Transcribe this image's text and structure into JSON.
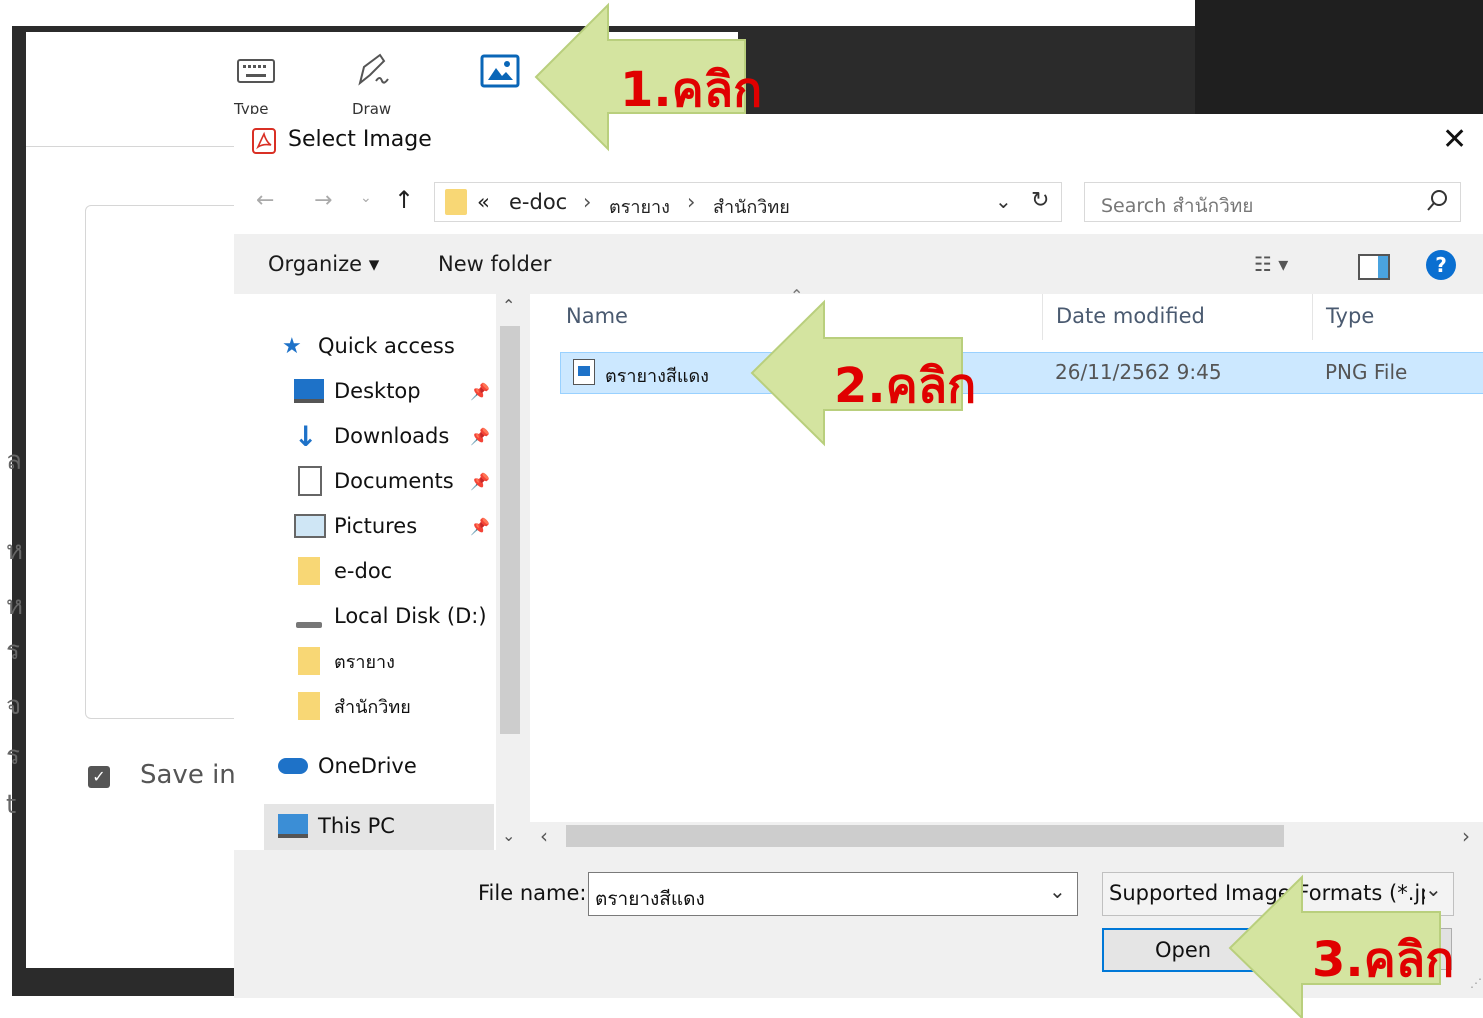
{
  "colors": {
    "accent": "#0078d7",
    "selection": "#cce8ff",
    "annotation_arrow": "#d4e4a0",
    "annotation_text": "#e00000",
    "folder": "#f8d775"
  },
  "background_app": {
    "toolbar": [
      {
        "icon": "keyboard-icon",
        "label": "Type"
      },
      {
        "icon": "draw-pen-icon",
        "label": "Draw"
      },
      {
        "icon": "image-icon",
        "label": "Image"
      }
    ],
    "save_label": "Save in",
    "save_checked": true,
    "edge_fragments": [
      "ล",
      "ห",
      "ห",
      "ร",
      "จ",
      "ร",
      "t"
    ]
  },
  "dialog": {
    "title": "Select Image",
    "close_glyph": "✕",
    "breadcrumb": {
      "prefix": "«",
      "parts": [
        "e-doc",
        "ตรายาง",
        "สำนักวิทย"
      ]
    },
    "search_placeholder": "Search สำนักวิทย",
    "toolbar": {
      "organize": "Organize ▾",
      "new_folder": "New folder"
    },
    "nav": [
      {
        "icon": "quick-access-star-icon",
        "label": "Quick access",
        "pinned": false
      },
      {
        "icon": "desktop-icon",
        "label": "Desktop",
        "pinned": true
      },
      {
        "icon": "downloads-icon",
        "label": "Downloads",
        "pinned": true
      },
      {
        "icon": "documents-icon",
        "label": "Documents",
        "pinned": true
      },
      {
        "icon": "pictures-icon",
        "label": "Pictures",
        "pinned": true
      },
      {
        "icon": "folder-icon",
        "label": "e-doc",
        "pinned": false
      },
      {
        "icon": "local-disk-icon",
        "label": "Local Disk (D:)",
        "pinned": false
      },
      {
        "icon": "folder-icon",
        "label": "ตรายาง",
        "pinned": false
      },
      {
        "icon": "folder-icon",
        "label": "สำนักวิทย",
        "pinned": false
      },
      {
        "icon": "onedrive-icon",
        "label": "OneDrive",
        "pinned": false
      },
      {
        "icon": "this-pc-icon",
        "label": "This PC",
        "pinned": false
      }
    ],
    "columns": {
      "name": "Name",
      "date": "Date modified",
      "type": "Type"
    },
    "files": [
      {
        "name": "ตรายางสีแดง",
        "date": "26/11/2562 9:45",
        "type": "PNG File",
        "selected": true
      }
    ],
    "file_name_label": "File name:",
    "file_name_value": "ตรายางสีแดง",
    "file_type_value": "Supported Image Formats (*.jp",
    "open_label": "Open"
  },
  "annotations": [
    "1.คลิก",
    "2.คลิก",
    "3.คลิก"
  ]
}
